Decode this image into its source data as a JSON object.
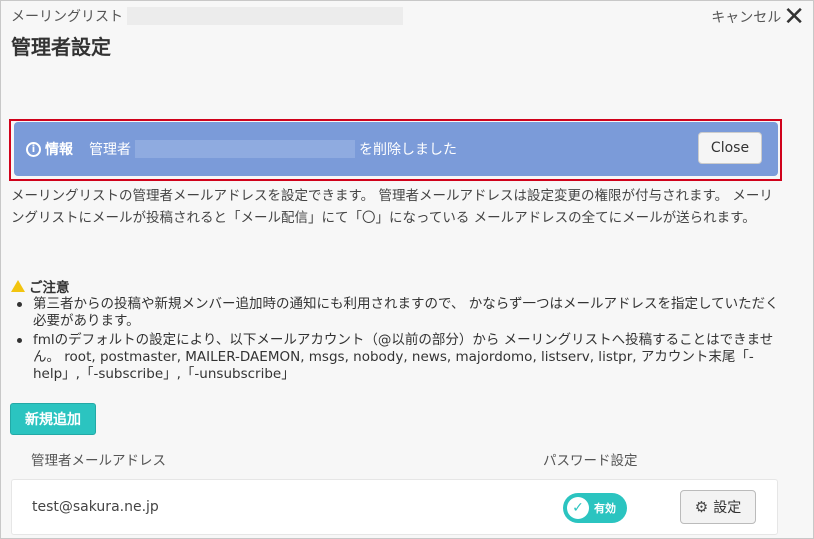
{
  "header": {
    "subtitle": "メーリングリスト",
    "title": "管理者設定",
    "cancel_label": "キャンセル",
    "close_glyph": "✕"
  },
  "alert": {
    "icon": "info-icon",
    "title": "情報",
    "message_prefix": "管理者",
    "message_suffix": "を削除しました",
    "close_label": "Close",
    "bg_color": "#7b9bd9"
  },
  "description": "メーリングリストの管理者メールアドレスを設定できます。 管理者メールアドレスは設定変更の権限が付与されます。 メーリングリストにメールが投稿されると「メール配信」にて「〇」になっている メールアドレスの全てにメールが送られます。",
  "notice": {
    "icon": "warning-icon",
    "heading": "ご注意",
    "items": [
      "第三者からの投稿や新規メンバー追加時の通知にも利用されますので、 かならず一つはメールアドレスを指定していただく必要があります。",
      "fmlのデフォルトの設定により、以下メールアカウント（@以前の部分）から メーリングリストへ投稿することはできません。 root, postmaster, MAILER-DAEMON, msgs, nobody, news, majordomo, listserv, listpr, アカウント末尾「-help」,「-subscribe」,「-unsubscribe」"
    ]
  },
  "actions": {
    "add_label": "新規追加",
    "accent_color": "#2bc4c0"
  },
  "table": {
    "columns": [
      "管理者メールアドレス",
      "パスワード設定"
    ],
    "rows": [
      {
        "email": "test@sakura.ne.jp",
        "status_label": "有効",
        "status_icon": "check-icon",
        "settings_label": "設定",
        "settings_icon": "gear-icon"
      }
    ]
  }
}
